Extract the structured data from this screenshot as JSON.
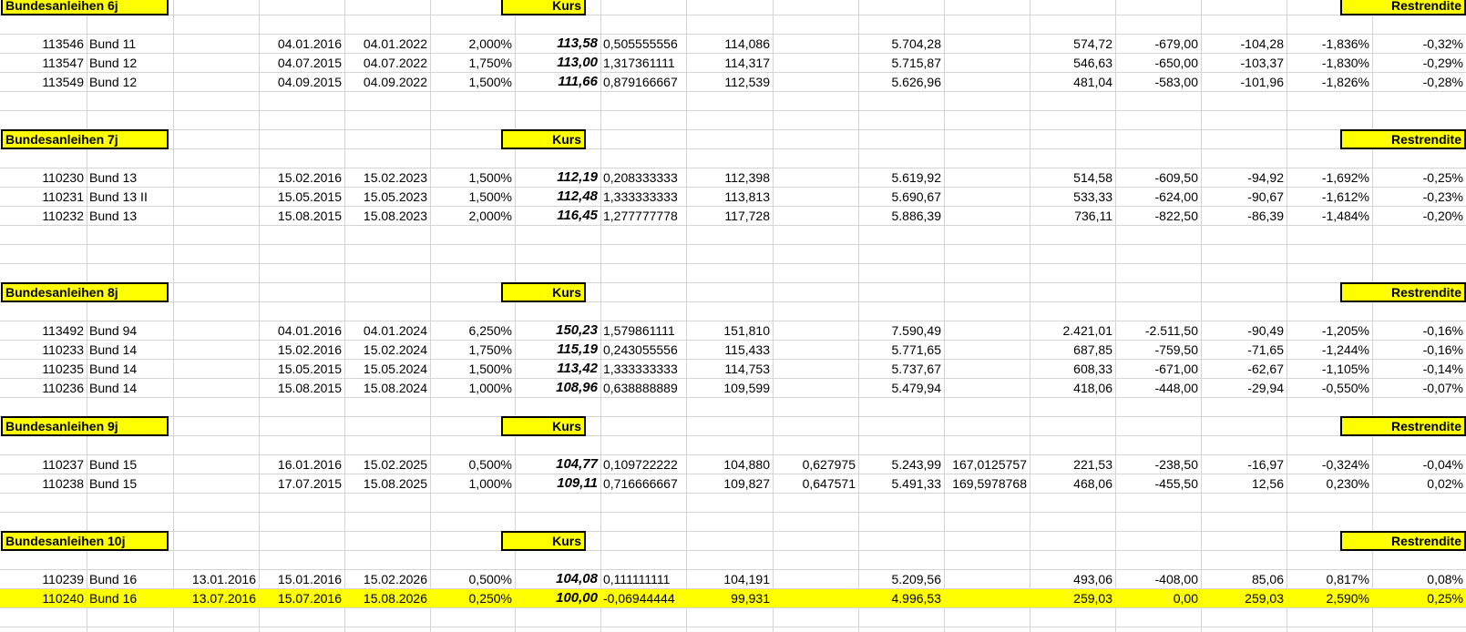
{
  "sections": [
    {
      "title": "Bundesanleihen 6j",
      "kurs_label": "Kurs",
      "restrendite_label": "Restrendite",
      "rows": [
        {
          "id": "113546",
          "name": "Bund 11",
          "c": "",
          "d": "04.01.2016",
          "e": "04.01.2022",
          "f": "2,000%",
          "kurs": "113,58",
          "h": "0,505555556",
          "i": "114,086",
          "j": "",
          "k": "5.704,28",
          "l": "",
          "m": "574,72",
          "n": "-679,00",
          "o": "-104,28",
          "p": "-1,836%",
          "q": "-0,32%"
        },
        {
          "id": "113547",
          "name": "Bund 12",
          "c": "",
          "d": "04.07.2015",
          "e": "04.07.2022",
          "f": "1,750%",
          "kurs": "113,00",
          "h": "1,317361111",
          "i": "114,317",
          "j": "",
          "k": "5.715,87",
          "l": "",
          "m": "546,63",
          "n": "-650,00",
          "o": "-103,37",
          "p": "-1,830%",
          "q": "-0,29%"
        },
        {
          "id": "113549",
          "name": "Bund 12",
          "c": "",
          "d": "04.09.2015",
          "e": "04.09.2022",
          "f": "1,500%",
          "kurs": "111,66",
          "h": "0,879166667",
          "i": "112,539",
          "j": "",
          "k": "5.626,96",
          "l": "",
          "m": "481,04",
          "n": "-583,00",
          "o": "-101,96",
          "p": "-1,826%",
          "q": "-0,28%"
        }
      ]
    },
    {
      "title": "Bundesanleihen 7j",
      "kurs_label": "Kurs",
      "restrendite_label": "Restrendite",
      "rows": [
        {
          "id": "110230",
          "name": "Bund 13",
          "c": "",
          "d": "15.02.2016",
          "e": "15.02.2023",
          "f": "1,500%",
          "kurs": "112,19",
          "h": "0,208333333",
          "i": "112,398",
          "j": "",
          "k": "5.619,92",
          "l": "",
          "m": "514,58",
          "n": "-609,50",
          "o": "-94,92",
          "p": "-1,692%",
          "q": "-0,25%"
        },
        {
          "id": "110231",
          "name": "Bund 13 II",
          "c": "",
          "d": "15.05.2015",
          "e": "15.05.2023",
          "f": "1,500%",
          "kurs": "112,48",
          "h": "1,333333333",
          "i": "113,813",
          "j": "",
          "k": "5.690,67",
          "l": "",
          "m": "533,33",
          "n": "-624,00",
          "o": "-90,67",
          "p": "-1,612%",
          "q": "-0,23%"
        },
        {
          "id": "110232",
          "name": "Bund 13",
          "c": "",
          "d": "15.08.2015",
          "e": "15.08.2023",
          "f": "2,000%",
          "kurs": "116,45",
          "h": "1,277777778",
          "i": "117,728",
          "j": "",
          "k": "5.886,39",
          "l": "",
          "m": "736,11",
          "n": "-822,50",
          "o": "-86,39",
          "p": "-1,484%",
          "q": "-0,20%"
        }
      ]
    },
    {
      "title": "Bundesanleihen 8j",
      "kurs_label": "Kurs",
      "restrendite_label": "Restrendite",
      "rows": [
        {
          "id": "113492",
          "name": "Bund 94",
          "c": "",
          "d": "04.01.2016",
          "e": "04.01.2024",
          "f": "6,250%",
          "kurs": "150,23",
          "h": "1,579861111",
          "i": "151,810",
          "j": "",
          "k": "7.590,49",
          "l": "",
          "m": "2.421,01",
          "n": "-2.511,50",
          "o": "-90,49",
          "p": "-1,205%",
          "q": "-0,16%"
        },
        {
          "id": "110233",
          "name": "Bund 14",
          "c": "",
          "d": "15.02.2016",
          "e": "15.02.2024",
          "f": "1,750%",
          "kurs": "115,19",
          "h": "0,243055556",
          "i": "115,433",
          "j": "",
          "k": "5.771,65",
          "l": "",
          "m": "687,85",
          "n": "-759,50",
          "o": "-71,65",
          "p": "-1,244%",
          "q": "-0,16%"
        },
        {
          "id": "110235",
          "name": "Bund 14",
          "c": "",
          "d": "15.05.2015",
          "e": "15.05.2024",
          "f": "1,500%",
          "kurs": "113,42",
          "h": "1,333333333",
          "i": "114,753",
          "j": "",
          "k": "5.737,67",
          "l": "",
          "m": "608,33",
          "n": "-671,00",
          "o": "-62,67",
          "p": "-1,105%",
          "q": "-0,14%"
        },
        {
          "id": "110236",
          "name": "Bund 14",
          "c": "",
          "d": "15.08.2015",
          "e": "15.08.2024",
          "f": "1,000%",
          "kurs": "108,96",
          "h": "0,638888889",
          "i": "109,599",
          "j": "",
          "k": "5.479,94",
          "l": "",
          "m": "418,06",
          "n": "-448,00",
          "o": "-29,94",
          "p": "-0,550%",
          "q": "-0,07%"
        }
      ]
    },
    {
      "title": "Bundesanleihen 9j",
      "kurs_label": "Kurs",
      "restrendite_label": "Restrendite",
      "rows": [
        {
          "id": "110237",
          "name": "Bund 15",
          "c": "",
          "d": "16.01.2016",
          "e": "15.02.2025",
          "f": "0,500%",
          "kurs": "104,77",
          "h": "0,109722222",
          "i": "104,880",
          "j": "0,627975",
          "k": "5.243,99",
          "l": "167,0125757",
          "m": "221,53",
          "n": "-238,50",
          "o": "-16,97",
          "p": "-0,324%",
          "q": "-0,04%"
        },
        {
          "id": "110238",
          "name": "Bund 15",
          "c": "",
          "d": "17.07.2015",
          "e": "15.08.2025",
          "f": "1,000%",
          "kurs": "109,11",
          "h": "0,716666667",
          "i": "109,827",
          "j": "0,647571",
          "k": "5.491,33",
          "l": "169,5978768",
          "m": "468,06",
          "n": "-455,50",
          "o": "12,56",
          "p": "0,230%",
          "q": "0,02%"
        }
      ]
    },
    {
      "title": "Bundesanleihen 10j",
      "kurs_label": "Kurs",
      "restrendite_label": "Restrendite",
      "rows": [
        {
          "id": "110239",
          "name": "Bund 16",
          "c": "13.01.2016",
          "d": "15.01.2016",
          "e": "15.02.2026",
          "f": "0,500%",
          "kurs": "104,08",
          "h": "0,111111111",
          "i": "104,191",
          "j": "",
          "k": "5.209,56",
          "l": "",
          "m": "493,06",
          "n": "-408,00",
          "o": "85,06",
          "p": "0,817%",
          "q": "0,08%"
        },
        {
          "id": "110240",
          "name": "Bund 16",
          "c": "13.07.2016",
          "d": "15.07.2016",
          "e": "15.08.2026",
          "f": "0,250%",
          "kurs": "100,00",
          "h": "-0,06944444",
          "i": "99,931",
          "j": "",
          "k": "4.996,53",
          "l": "",
          "m": "259,03",
          "n": "0,00",
          "o": "259,03",
          "p": "2,590%",
          "q": "0,25%",
          "highlight": true
        }
      ]
    }
  ]
}
